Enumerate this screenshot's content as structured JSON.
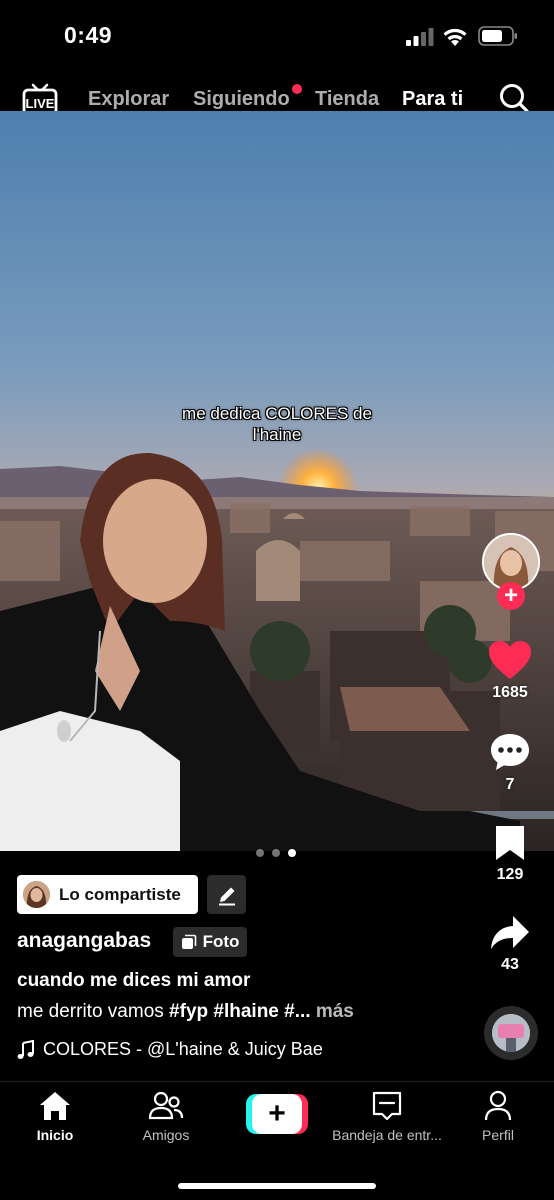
{
  "status_bar": {
    "time": "0:49"
  },
  "top_nav": {
    "live_label": "LIVE",
    "tabs": [
      {
        "label": "Explorar"
      },
      {
        "label": "Siguiendo"
      },
      {
        "label": "Tienda"
      },
      {
        "label": "Para ti"
      }
    ],
    "active_tab": "Para ti"
  },
  "post": {
    "overlay_text": [
      "me dedica COLORES de",
      "l'haine"
    ],
    "photo_count": 3,
    "active_photo": 3,
    "shared_label": "Lo compartiste",
    "username": "anagangabas",
    "type_badge": "Foto",
    "title": "cuando me dices mi amor",
    "description": "me derrito vamos ",
    "description_tags": "#fyp #lhaine #...",
    "more_label": "más",
    "sound": "COLORES - @L'haine & Juicy Bae"
  },
  "actions": {
    "likes": "1685",
    "comments": "7",
    "saves": "129",
    "shares": "43"
  },
  "bottom_nav": {
    "items": [
      {
        "label": "Inicio"
      },
      {
        "label": "Amigos"
      },
      {
        "label": "Bandeja de entr..."
      },
      {
        "label": "Perfil"
      }
    ]
  },
  "colors": {
    "accent": "#fe2c55",
    "cyan": "#25f4ee",
    "background": "#000000"
  }
}
